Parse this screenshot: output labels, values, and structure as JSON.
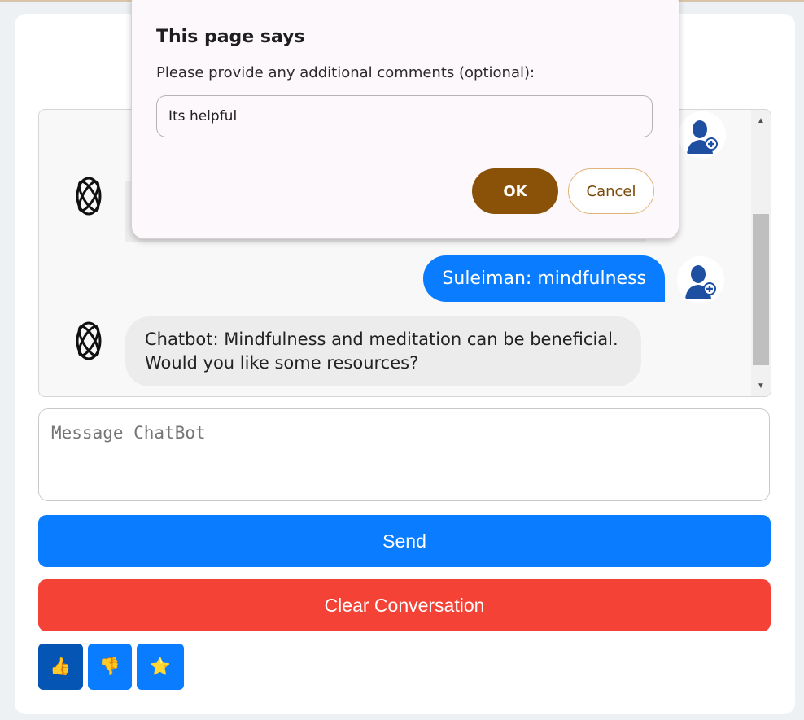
{
  "chat": {
    "messages": [
      {
        "sender": "user",
        "text": "Suleiman: mindfulness"
      },
      {
        "sender": "bot",
        "text": "Chatbot: Mindfulness and meditation can be beneficial. Would you like some resources?"
      }
    ]
  },
  "composer": {
    "placeholder": "Message ChatBot",
    "value": ""
  },
  "actions": {
    "send_label": "Send",
    "clear_label": "Clear Conversation"
  },
  "feedback": [
    {
      "icon": "thumbs-up-icon",
      "glyph": "👍",
      "active": true
    },
    {
      "icon": "thumbs-down-icon",
      "glyph": "👎",
      "active": false
    },
    {
      "icon": "star-icon",
      "glyph": "⭐",
      "active": false
    }
  ],
  "dialog": {
    "title": "This page says",
    "message": "Please provide any additional comments (optional):",
    "input_value": "Its helpful",
    "ok_label": "OK",
    "cancel_label": "Cancel"
  },
  "colors": {
    "primary": "#0a7cff",
    "danger": "#f44336",
    "dialog_ok": "#8a5208"
  }
}
